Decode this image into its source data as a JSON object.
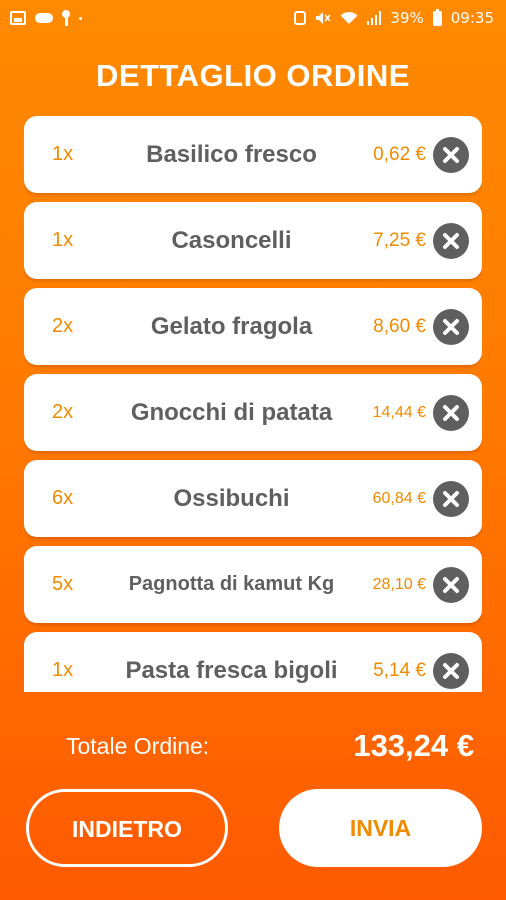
{
  "status_bar": {
    "battery": "39%",
    "time": "09:35",
    "icons": [
      "image-icon",
      "cloud-icon",
      "key-icon",
      "dot-icon",
      "alarm-icon",
      "mute-icon",
      "wifi-icon",
      "signal-icon",
      "battery-icon"
    ]
  },
  "page": {
    "title": "DETTAGLIO ORDINE"
  },
  "order": {
    "items": [
      {
        "qty": "1x",
        "name": "Basilico fresco",
        "price": "0,62 €"
      },
      {
        "qty": "1x",
        "name": "Casoncelli",
        "price": "7,25 €"
      },
      {
        "qty": "2x",
        "name": "Gelato fragola",
        "price": "8,60 €"
      },
      {
        "qty": "2x",
        "name": "Gnocchi di patata",
        "price": "14,44 €"
      },
      {
        "qty": "6x",
        "name": "Ossibuchi",
        "price": "60,84 €"
      },
      {
        "qty": "5x",
        "name": "Pagnotta di kamut Kg",
        "price": "28,10 €"
      },
      {
        "qty": "1x",
        "name": "Pasta fresca bigoli",
        "price": "5,14 €"
      }
    ],
    "total_label": "Totale Ordine:",
    "total_value": "133,24 €"
  },
  "actions": {
    "back_label": "INDIETRO",
    "send_label": "INVIA"
  },
  "colors": {
    "accent": "#f08a00",
    "background_top": "#ff8a00",
    "background_bottom": "#ff5a00",
    "text_dark": "#5f5f5f"
  }
}
